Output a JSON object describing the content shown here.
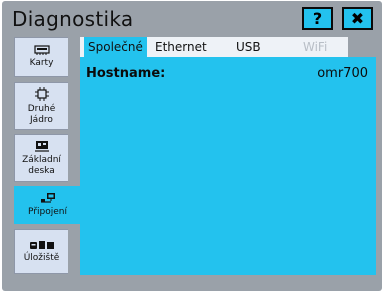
{
  "window": {
    "title": "Diagnostika",
    "help_label": "?",
    "close_label": "✖"
  },
  "sidebar": {
    "items": [
      {
        "label": "Karty",
        "icon": "card-icon"
      },
      {
        "label": "Druhé\nJádro",
        "icon": "chip-icon"
      },
      {
        "label": "Základní\ndeska",
        "icon": "motherboard-icon"
      },
      {
        "label": "Připojení",
        "icon": "network-icon",
        "active": true
      },
      {
        "label": "Úložiště",
        "icon": "storage-icon"
      }
    ]
  },
  "tabs": [
    "Společné",
    "Ethernet",
    "USB",
    "WiFi"
  ],
  "content": {
    "hostname_label": "Hostname:",
    "hostname_value": "omr700"
  },
  "colors": {
    "accent": "#23c2ee",
    "frame": "#9aa1a9",
    "sidebar_bg": "#d7e1f1"
  }
}
